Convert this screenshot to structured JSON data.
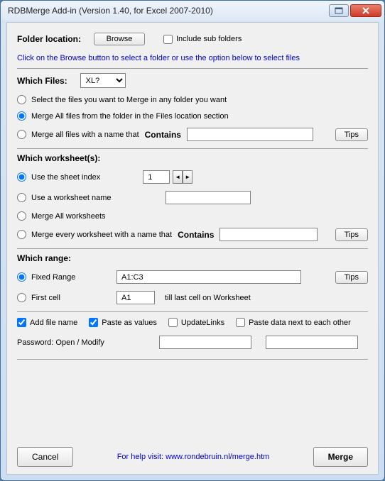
{
  "window": {
    "title": "RDBMerge Add-in (Version 1.40, for Excel 2007-2010)"
  },
  "folder": {
    "label": "Folder location:",
    "browse": "Browse",
    "include_sub": "Include sub folders",
    "hint": "Click on the Browse button to select a folder or use the option below to select files"
  },
  "files": {
    "heading": "Which Files:",
    "dropdown": "XL?",
    "opt_select": "Select the files you want to Merge in any folder you want",
    "opt_all": "Merge All files from the folder in the Files location section",
    "opt_name_prefix": "Merge all files with a name that",
    "contains": "Contains",
    "tips": "Tips"
  },
  "sheets": {
    "heading": "Which worksheet(s):",
    "opt_index": "Use the sheet index",
    "index_value": "1",
    "opt_name": "Use a worksheet name",
    "opt_all": "Merge All worksheets",
    "opt_every_prefix": "Merge every worksheet with a name that",
    "contains": "Contains",
    "tips": "Tips"
  },
  "range": {
    "heading": "Which range:",
    "opt_fixed": "Fixed Range",
    "fixed_value": "A1:C3",
    "opt_firstcell": "First cell",
    "firstcell_value": "A1",
    "firstcell_suffix": "till last cell on Worksheet",
    "tips": "Tips"
  },
  "opts": {
    "add_filename": "Add file name",
    "paste_values": "Paste as values",
    "update_links": "UpdateLinks",
    "paste_next": "Paste data next to each other",
    "password_label": "Password: Open / Modify"
  },
  "footer": {
    "cancel": "Cancel",
    "help_prefix": "For help visit: ",
    "help_url": "www.rondebruin.nl/merge.htm",
    "merge": "Merge"
  }
}
